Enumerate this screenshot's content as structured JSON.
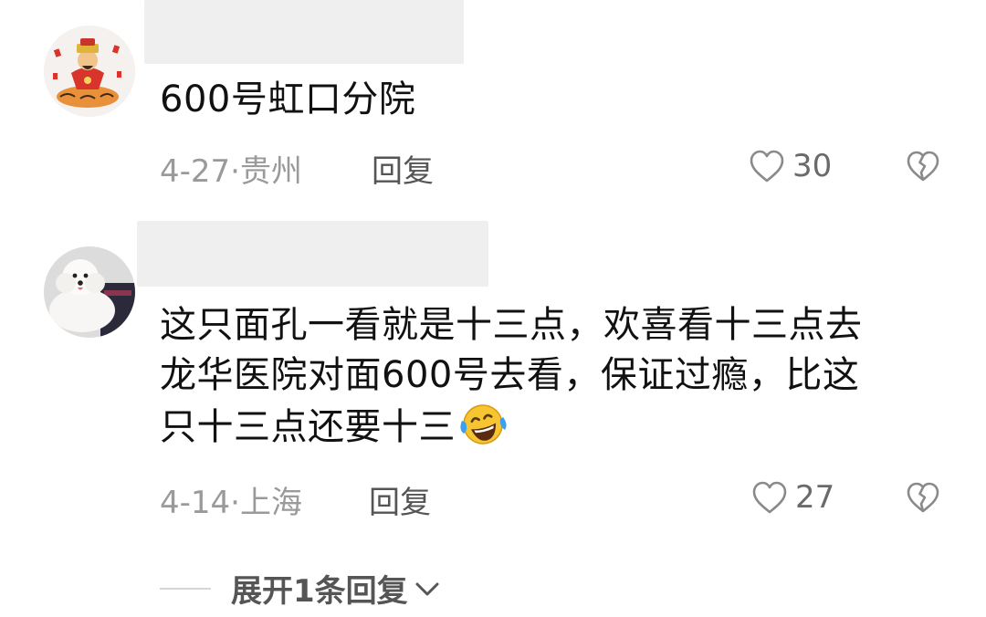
{
  "comments": [
    {
      "avatar_icon": "god-of-wealth-avatar-icon",
      "text_lines": [
        "600号虹口分院"
      ],
      "date": "4-27",
      "location": "贵州",
      "reply_label": "回复",
      "like_count": "30"
    },
    {
      "avatar_icon": "white-dog-avatar-icon",
      "text_lines": [
        "这只面孔一看就是十三点，欢喜看十三点去",
        "龙华医院对面600号去看，保证过瘾，比这",
        "只十三点还要十三"
      ],
      "emoji": "laughing-tears-emoji",
      "date": "4-14",
      "location": "上海",
      "reply_label": "回复",
      "like_count": "27"
    }
  ],
  "expand_replies_label": "展开1条回复",
  "colors": {
    "text": "#111111",
    "meta": "#9a9a9a",
    "action": "#555555",
    "redacted": "#efefef"
  }
}
